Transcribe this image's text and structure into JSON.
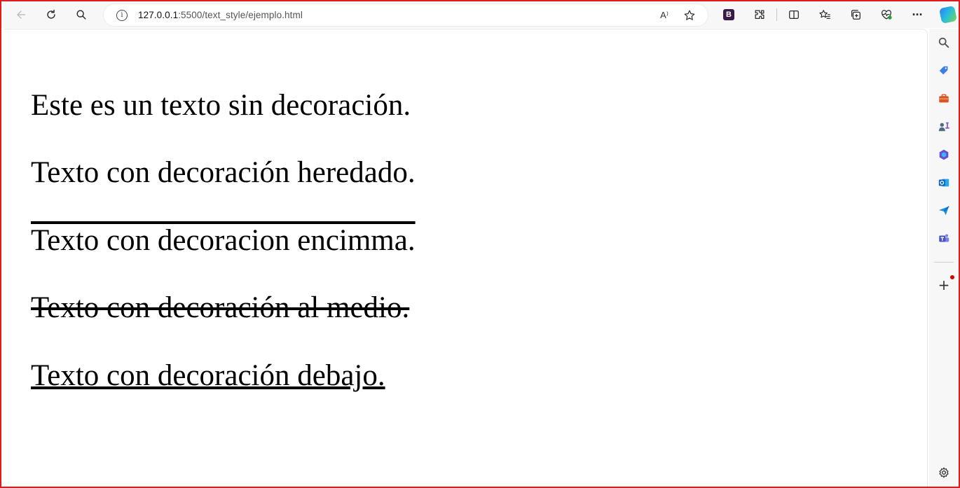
{
  "browser": {
    "url_host": "127.0.0.1",
    "url_rest": ":5500/text_style/ejemplo.html",
    "read_aloud_label": "A⁾"
  },
  "toolbar_icons": [
    "back-icon",
    "refresh-icon",
    "search-icon",
    "info-icon",
    "read-aloud-icon",
    "favorite-star-icon",
    "bootstrap-extension-icon",
    "extensions-icon",
    "split-screen-icon",
    "favorites-icon",
    "collections-icon",
    "browser-essentials-icon",
    "more-icon",
    "copilot-icon"
  ],
  "extension_badge": "B",
  "more_label": "···",
  "content": {
    "line1": "Este es un texto sin decoración.",
    "line2": "Texto con decoración heredado.",
    "line3": "Texto con decoracion encimma.",
    "line4": "Texto con decoración al medio.",
    "line5": "Texto con decoración debajo."
  },
  "sidebar_icons": [
    "search-icon",
    "shopping-tag-icon",
    "tools-icon",
    "games-icon",
    "microsoft365-icon",
    "outlook-icon",
    "send-icon",
    "teams-icon",
    "add-icon",
    "settings-icon"
  ],
  "sidebar_add_label": "+",
  "colors": {
    "frame": "#e01b1b",
    "text": "#000000",
    "toolbar_bg": "#f7f7f7"
  }
}
